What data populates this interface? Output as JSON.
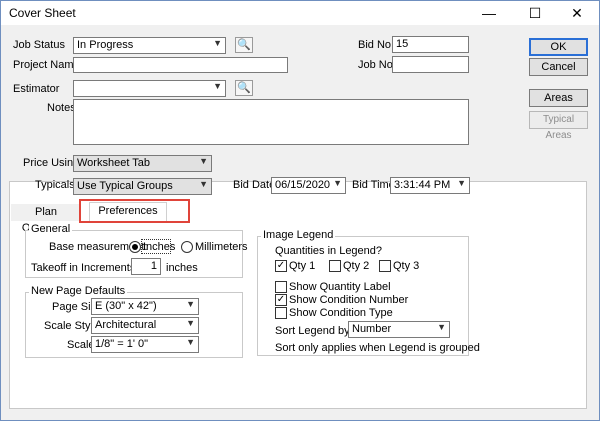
{
  "window": {
    "title": "Cover Sheet",
    "minimize_icon": "minimize-icon",
    "maximize_icon": "maximize-icon",
    "close_icon": "close-icon"
  },
  "header": {
    "job_status_label": "Job Status",
    "job_status_value": "In Progress",
    "project_name_label": "Project Name",
    "project_name_value": "",
    "estimator_label": "Estimator",
    "estimator_value": "",
    "notes_label": "Notes",
    "notes_value": "",
    "bid_no_label": "Bid No.",
    "bid_no_value": "15",
    "job_no_label": "Job No.",
    "job_no_value": "",
    "price_using_label": "Price Using",
    "price_using_value": "Worksheet Tab",
    "typicals_label": "Typicals",
    "typicals_value": "Use Typical Groups",
    "bid_date_label": "Bid Date",
    "bid_date_value": "06/15/2020",
    "bid_time_label": "Bid Time",
    "bid_time_value": "3:31:44 PM"
  },
  "buttons": {
    "ok": "OK",
    "cancel": "Cancel",
    "areas": "Areas",
    "typical_areas": "Typical Areas"
  },
  "tabs": [
    {
      "label": "Plan Organizer",
      "active": false
    },
    {
      "label": "Preferences",
      "active": true
    }
  ],
  "general": {
    "title": "General",
    "base_measurement_label": "Base measurement:",
    "inches_label": "Inches",
    "millimeters_label": "Millimeters",
    "selected_unit": "Inches",
    "takeoff_label": "Takeoff in Increments of",
    "takeoff_value": "1",
    "takeoff_unit": "inches"
  },
  "new_page": {
    "title": "New Page Defaults",
    "page_size_label": "Page Size",
    "page_size_value": "E (30\" x 42\")",
    "scale_style_label": "Scale Style",
    "scale_style_value": "Architectural",
    "scale_label": "Scale",
    "scale_value": "1/8\" = 1' 0\""
  },
  "image_legend": {
    "title": "Image Legend",
    "quantities_label": "Quantities in Legend?",
    "qty1_label": "Qty 1",
    "qty1_checked": true,
    "qty2_label": "Qty 2",
    "qty2_checked": false,
    "qty3_label": "Qty 3",
    "qty3_checked": false,
    "show_quantity_label": "Show Quantity Label",
    "show_quantity_checked": false,
    "show_condition_number": "Show Condition Number",
    "show_condition_number_checked": true,
    "show_condition_type": "Show Condition Type",
    "show_condition_type_checked": false,
    "sort_legend_label": "Sort Legend by:",
    "sort_legend_value": "Number",
    "sort_note": "Sort only applies when Legend is grouped"
  },
  "colors": {
    "highlight": "#e0443a",
    "default_button_border": "#2a6fd6"
  }
}
